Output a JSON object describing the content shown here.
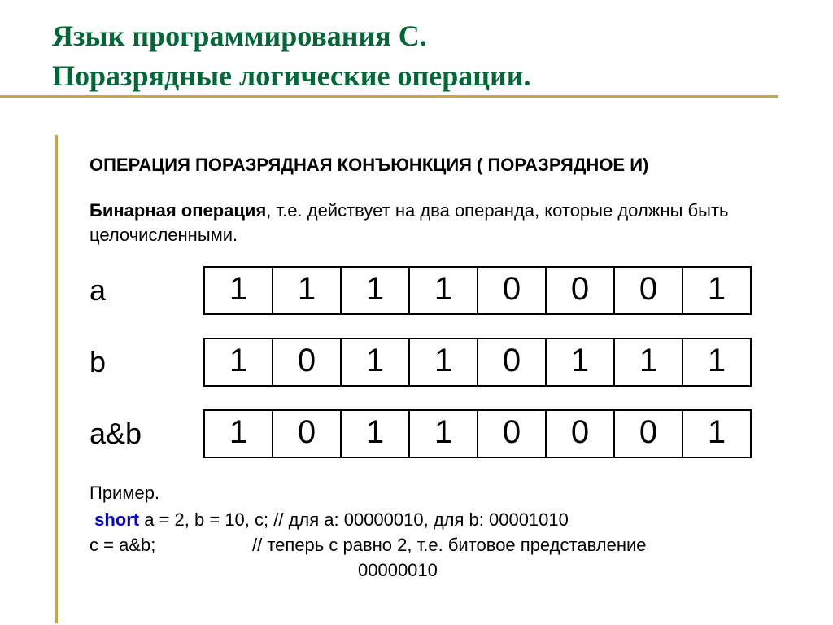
{
  "title_line1": "Язык программирования С.",
  "title_line2": " Поразрядные логические операции.",
  "section_heading": "ОПЕРАЦИЯ ПОРАЗРЯДНАЯ КОНЪЮНКЦИЯ ( ПОРАЗРЯДНОЕ И)",
  "para_bold": "Бинарная операция",
  "para_rest": ", т.е. действует на два операнда, которые должны быть целочисленными.",
  "rows": {
    "a": {
      "label": "a",
      "bits": [
        "1",
        "1",
        "1",
        "1",
        "0",
        "0",
        "0",
        "1"
      ]
    },
    "b": {
      "label": "b",
      "bits": [
        "1",
        "0",
        "1",
        "1",
        "0",
        "1",
        "1",
        "1"
      ]
    },
    "r": {
      "label": "a&b",
      "bits": [
        "1",
        "0",
        "1",
        "1",
        "0",
        "0",
        "0",
        "1"
      ]
    }
  },
  "example": {
    "header": "Пример.",
    "kw": "short",
    "decl": " a = 2, b = 10, c; // для a: 00000010, для b: 00001010",
    "assign_lhs": " c = a&b;",
    "assign_rhs": "// теперь c равно 2, т.е. битовое представление",
    "tail": "00000010"
  }
}
